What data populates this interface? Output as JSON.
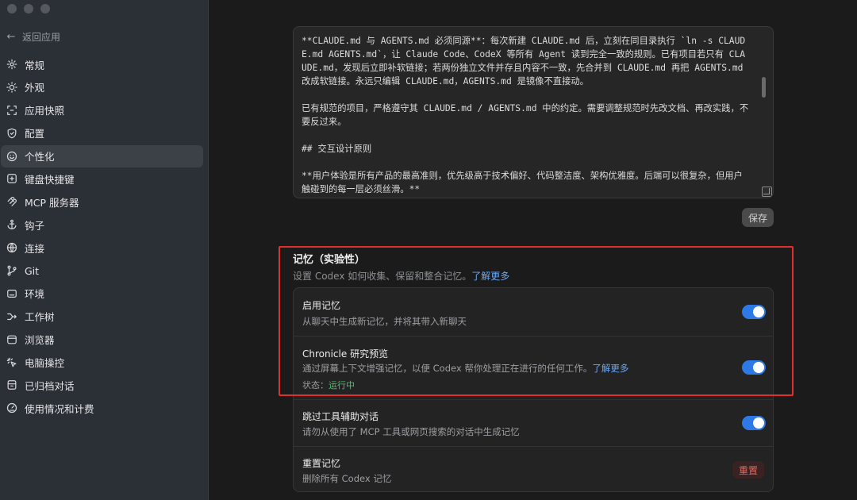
{
  "sidebar": {
    "back_label": "返回应用",
    "items": [
      {
        "label": "常规",
        "icon": "gear-icon"
      },
      {
        "label": "外观",
        "icon": "sun-icon"
      },
      {
        "label": "应用快照",
        "icon": "snapshot-icon"
      },
      {
        "label": "配置",
        "icon": "shield-icon"
      },
      {
        "label": "个性化",
        "icon": "smile-icon",
        "active": true
      },
      {
        "label": "键盘快捷键",
        "icon": "keyboard-icon"
      },
      {
        "label": "MCP 服务器",
        "icon": "mcp-icon"
      },
      {
        "label": "钩子",
        "icon": "anchor-icon"
      },
      {
        "label": "连接",
        "icon": "globe-icon"
      },
      {
        "label": "Git",
        "icon": "git-branch-icon"
      },
      {
        "label": "环境",
        "icon": "monitor-icon"
      },
      {
        "label": "工作树",
        "icon": "worktree-icon"
      },
      {
        "label": "浏览器",
        "icon": "browser-icon"
      },
      {
        "label": "电脑操控",
        "icon": "cursor-click-icon"
      },
      {
        "label": "已归档对话",
        "icon": "archive-icon"
      },
      {
        "label": "使用情况和计费",
        "icon": "gauge-icon"
      }
    ]
  },
  "editor": {
    "paragraphs": [
      "**CLAUDE.md 与 AGENTS.md 必须同源**：每次新建 CLAUDE.md 后，立刻在同目录执行 `ln -s CLAUDE.md AGENTS.md`，让 Claude Code、CodeX 等所有 Agent 读到完全一致的规则。已有项目若只有 CLAUDE.md，发现后立即补软链接；若两份独立文件并存且内容不一致，先合并到 CLAUDE.md 再把 AGENTS.md 改成软链接。永远只编辑 CLAUDE.md，AGENTS.md 是镜像不直接动。",
      "已有规范的项目，严格遵守其 CLAUDE.md / AGENTS.md 中的约定。需要调整规范时先改文档、再改实践，不要反过来。",
      "## 交互设计原则",
      "**用户体验是所有产品的最高准则，优先级高于技术偏好、代码整洁度、架构优雅度。后端可以很复杂，但用户触碰到的每一层必须丝滑。**"
    ],
    "save_label": "保存"
  },
  "memory": {
    "title": "记忆（实验性）",
    "desc": "设置 Codex 如何收集、保留和整合记忆。",
    "learn_more": "了解更多",
    "rows": [
      {
        "title": "启用记忆",
        "desc": "从聊天中生成新记忆，并将其带入新聊天",
        "enabled": true
      },
      {
        "title": "Chronicle 研究预览",
        "desc": "通过屏幕上下文增强记忆，以便 Codex 帮你处理正在进行的任何工作。",
        "learn_more": "了解更多",
        "status_label": "状态：",
        "status_value": "运行中",
        "enabled": true
      },
      {
        "title": "跳过工具辅助对话",
        "desc": "请勿从使用了 MCP 工具或网页搜索的对话中生成记忆",
        "enabled": true
      },
      {
        "title": "重置记忆",
        "desc": "删除所有 Codex 记忆",
        "button_label": "重置"
      }
    ]
  },
  "colors": {
    "accent": "#2d7ae6",
    "highlight": "#e0302d",
    "status_ok": "#4fc36b",
    "danger": "#e06a5c"
  }
}
